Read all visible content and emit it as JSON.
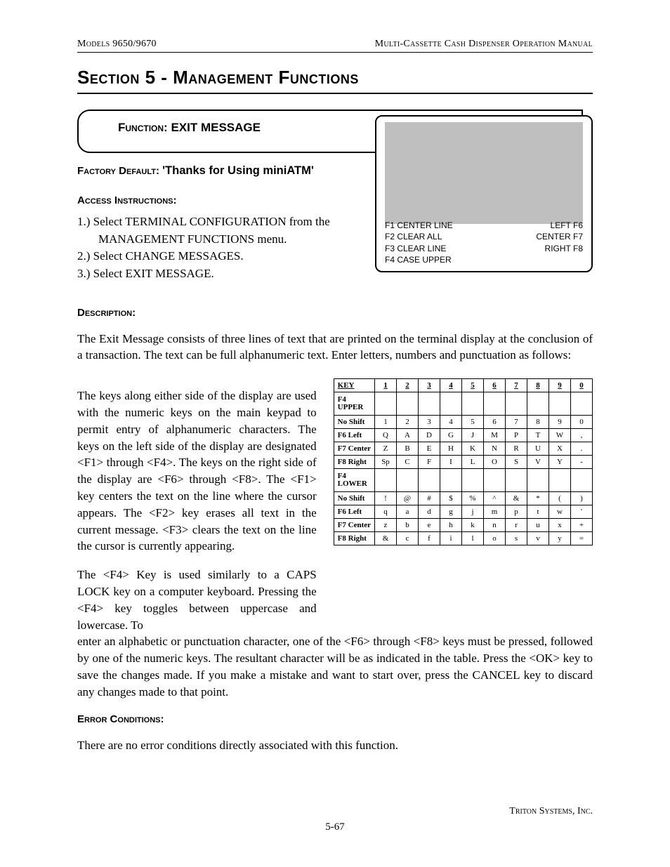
{
  "header": {
    "left": "Models 9650/9670",
    "right": "Multi-Cassette Cash Dispenser Operation Manual"
  },
  "section_title": "Section 5 - Management Functions",
  "function_box": {
    "prefix": "Function:  ",
    "value": "EXIT MESSAGE"
  },
  "factory_default": {
    "prefix": "Factory Default: ",
    "value": "'Thanks for Using miniATM'"
  },
  "access_heading": "Access Instructions:",
  "access_steps": [
    "Select TERMINAL CONFIGURATION from the MANAGEMENT FUNCTIONS menu.",
    "Select CHANGE MESSAGES.",
    "Select EXIT MESSAGE."
  ],
  "screen": {
    "left_lines": [
      "F1 CENTER LINE",
      "F2 CLEAR ALL",
      "F3 CLEAR LINE",
      "F4 CASE UPPER"
    ],
    "right_lines": [
      "LEFT F6",
      "CENTER F7",
      "RIGHT F8"
    ]
  },
  "description_heading": "Description:",
  "desc_p1": "The Exit Message consists of three lines of text that are printed on the terminal display at the conclusion of a transaction.  The text can be full alphanumeric text.  Enter letters, numbers and punctuation as follows:",
  "desc_p2": "The keys along either side of the display are used with the numeric keys on the main keypad to permit entry of alphanumeric characters.  The keys on the left side of the display are designated <F1> through <F4>.  The keys on the right side of the display are <F6> through <F8>. The <F1> key centers the text on the line where the cursor appears.  The <F2> key erases all text in the current message.  <F3> clears the text on the line the cursor is currently appearing.",
  "desc_p3a": "The <F4> Key is used similarly to a CAPS LOCK key on a computer keyboard.  Pressing the <F4> key toggles between uppercase and lowercase.  To",
  "desc_p3b": "enter an alphabetic or punctuation character, one of the <F6> through <F8> keys must be pressed, followed by one of the numeric keys.  The resultant character will be as indicated in the table. Press the <OK> key to save the changes made.  If you make a mistake and want to start over, press the CANCEL key to discard any changes made to that point.",
  "error_heading": "Error Conditions:",
  "error_text": "There are no error conditions directly associated with this function.",
  "table": {
    "key_col": "KEY",
    "headers": [
      "1",
      "2",
      "3",
      "4",
      "5",
      "6",
      "7",
      "8",
      "9",
      "0"
    ],
    "sections": [
      {
        "title": "F4 UPPER",
        "rows": [
          {
            "label": "No Shift",
            "cells": [
              "1",
              "2",
              "3",
              "4",
              "5",
              "6",
              "7",
              "8",
              "9",
              "0"
            ]
          },
          {
            "label": "F6 Left",
            "cells": [
              "Q",
              "A",
              "D",
              "G",
              "J",
              "M",
              "P",
              "T",
              "W",
              ","
            ]
          },
          {
            "label": "F7 Center",
            "cells": [
              "Z",
              "B",
              "E",
              "H",
              "K",
              "N",
              "R",
              "U",
              "X",
              "."
            ]
          },
          {
            "label": "F8 Right",
            "cells": [
              "Sp",
              "C",
              "F",
              "I",
              "L",
              "O",
              "S",
              "V",
              "Y",
              "-"
            ]
          }
        ]
      },
      {
        "title": "F4 LOWER",
        "rows": [
          {
            "label": "No Shift",
            "cells": [
              "!",
              "@",
              "#",
              "$",
              "%",
              "^",
              "&",
              "*",
              "(",
              ")"
            ]
          },
          {
            "label": "F6 Left",
            "cells": [
              "q",
              "a",
              "d",
              "g",
              "j",
              "m",
              "p",
              "t",
              "w",
              "'"
            ]
          },
          {
            "label": "F7 Center",
            "cells": [
              "z",
              "b",
              "e",
              "h",
              "k",
              "n",
              "r",
              "u",
              "x",
              "+"
            ]
          },
          {
            "label": "F8 Right",
            "cells": [
              "&",
              "c",
              "f",
              "i",
              "l",
              "o",
              "s",
              "v",
              "y",
              "="
            ]
          }
        ]
      }
    ]
  },
  "footer": {
    "company": "Triton Systems, Inc.",
    "page": "5-67"
  }
}
